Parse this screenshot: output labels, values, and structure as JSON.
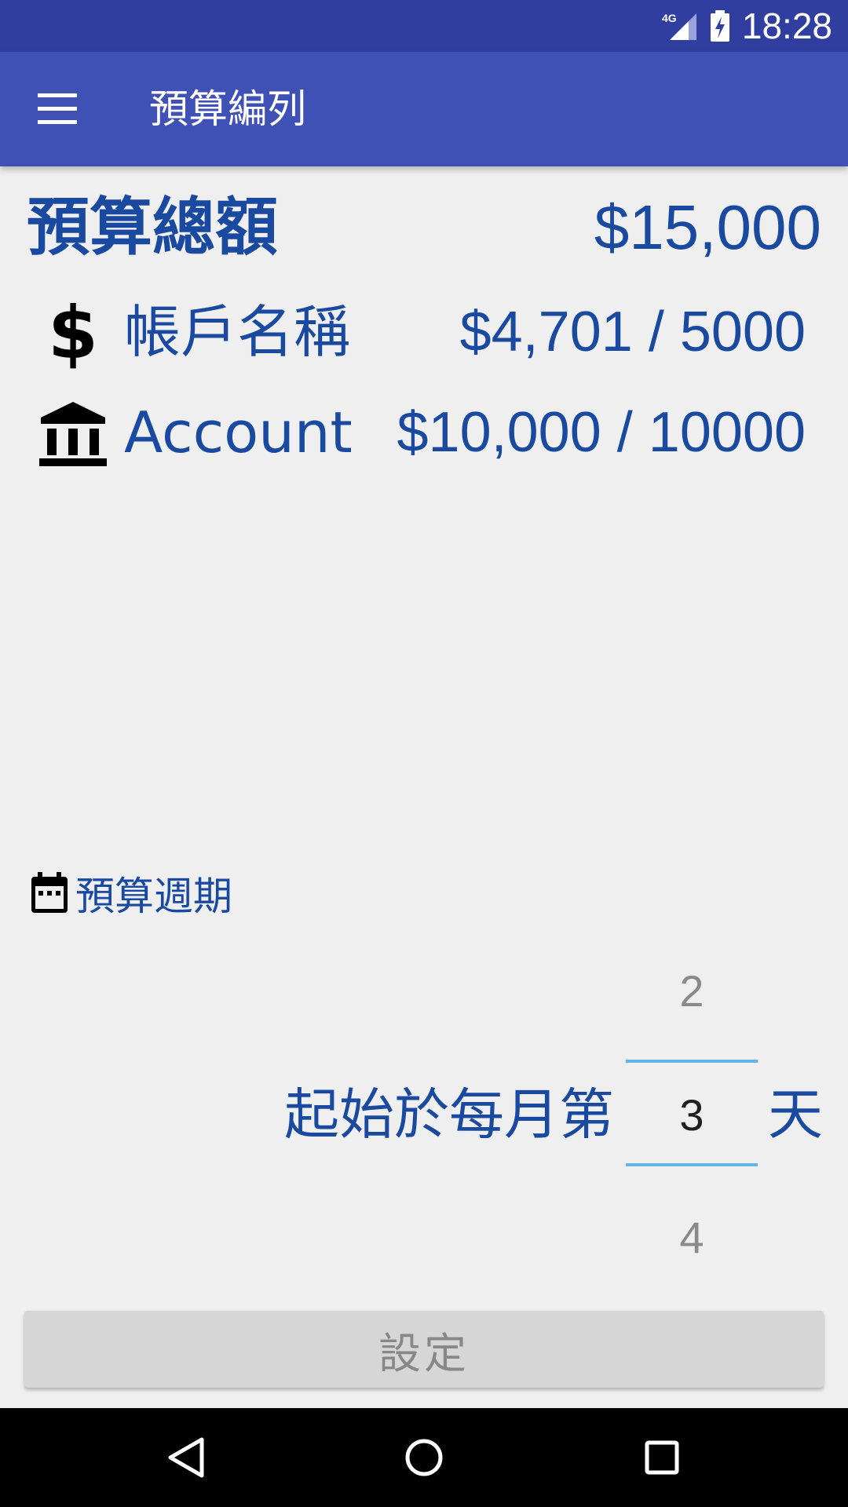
{
  "status_bar": {
    "network": "4G",
    "time": "18:28"
  },
  "app_bar": {
    "title": "預算編列",
    "menu_icon": "hamburger-menu-icon"
  },
  "budget": {
    "total_label": "預算總額",
    "total_value": "$15,000",
    "accounts": [
      {
        "icon": "dollar-icon",
        "name": "帳戶名稱",
        "value": "$4,701 / 5000"
      },
      {
        "icon": "bank-icon",
        "name": "Account",
        "value": "$10,000 / 10000"
      }
    ]
  },
  "period": {
    "icon": "calendar-icon",
    "label": "預算週期",
    "prefix": "起始於每月第",
    "suffix": "天",
    "picker": {
      "prev": "2",
      "selected": "3",
      "next": "4"
    }
  },
  "set_button": {
    "label": "設定"
  },
  "nav_bar": {
    "buttons": [
      "back-icon",
      "home-icon",
      "recents-icon"
    ]
  },
  "colors": {
    "status_bar": "#303f9f",
    "app_bar": "#3f51b5",
    "text_blue": "#1a4aa0",
    "picker_line": "#64b5e6",
    "background": "#efeff0"
  }
}
